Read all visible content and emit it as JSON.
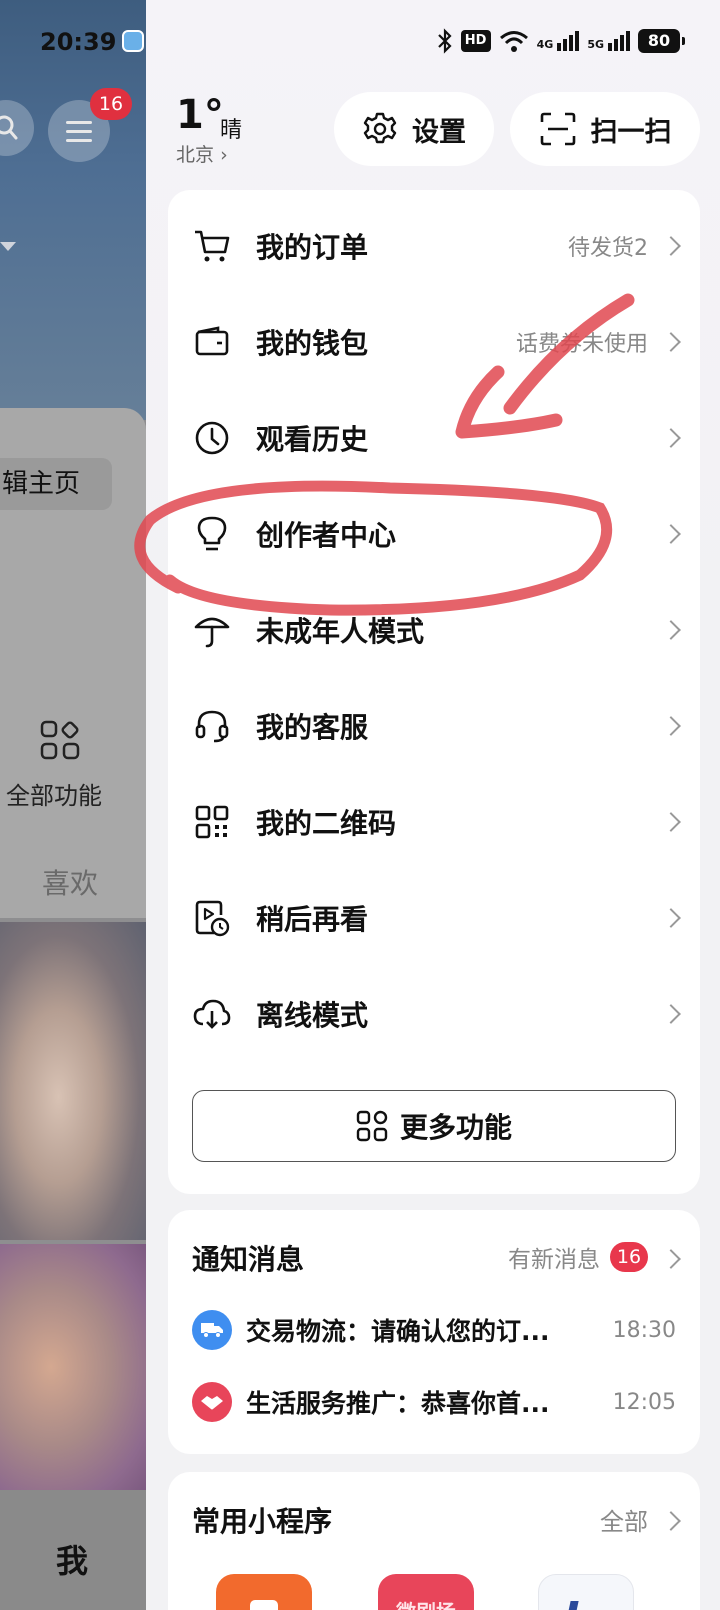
{
  "background_page": {
    "time": "20:39",
    "menu_badge": "16",
    "edit_home": "辑主页",
    "all_functions": "全部功能",
    "like_tab": "喜欢",
    "me_tab": "我"
  },
  "status_bar": {
    "hd": "HD",
    "net_4g": "4G",
    "net_5g": "5G",
    "battery": "80"
  },
  "weather": {
    "temp": "1°",
    "condition": "晴",
    "city": "北京",
    "city_chevron": "›"
  },
  "header_buttons": {
    "settings": "设置",
    "scan": "扫一扫"
  },
  "menu": {
    "items": [
      {
        "label": "我的订单",
        "sub": "待发货2",
        "icon": "cart-icon"
      },
      {
        "label": "我的钱包",
        "sub": "话费券未使用",
        "icon": "wallet-icon"
      },
      {
        "label": "观看历史",
        "sub": "",
        "icon": "clock-icon"
      },
      {
        "label": "创作者中心",
        "sub": "",
        "icon": "lightbulb-icon"
      },
      {
        "label": "未成年人模式",
        "sub": "",
        "icon": "umbrella-icon"
      },
      {
        "label": "我的客服",
        "sub": "",
        "icon": "headset-icon"
      },
      {
        "label": "我的二维码",
        "sub": "",
        "icon": "qrcode-icon"
      },
      {
        "label": "稍后再看",
        "sub": "",
        "icon": "watch-later-icon"
      },
      {
        "label": "离线模式",
        "sub": "",
        "icon": "cloud-download-icon"
      }
    ],
    "more_label": "更多功能"
  },
  "notifications": {
    "title": "通知消息",
    "new_label": "有新消息",
    "badge": "16",
    "items": [
      {
        "text": "交易物流：请确认您的订...",
        "time": "18:30",
        "icon": "truck-icon",
        "color": "#3f8ef0"
      },
      {
        "text": "生活服务推广：恭喜你首...",
        "time": "12:05",
        "icon": "handshake-icon",
        "color": "#e8455a"
      }
    ]
  },
  "mini_programs": {
    "title": "常用小程序",
    "all_label": "全部",
    "apps": [
      {
        "color": "#f26a2d"
      },
      {
        "color": "#e8455a",
        "label": "微剧场"
      },
      {
        "color": "#f5f7fb"
      }
    ]
  },
  "colors": {
    "annotation": "#e04850",
    "badge": "#e8374c"
  }
}
